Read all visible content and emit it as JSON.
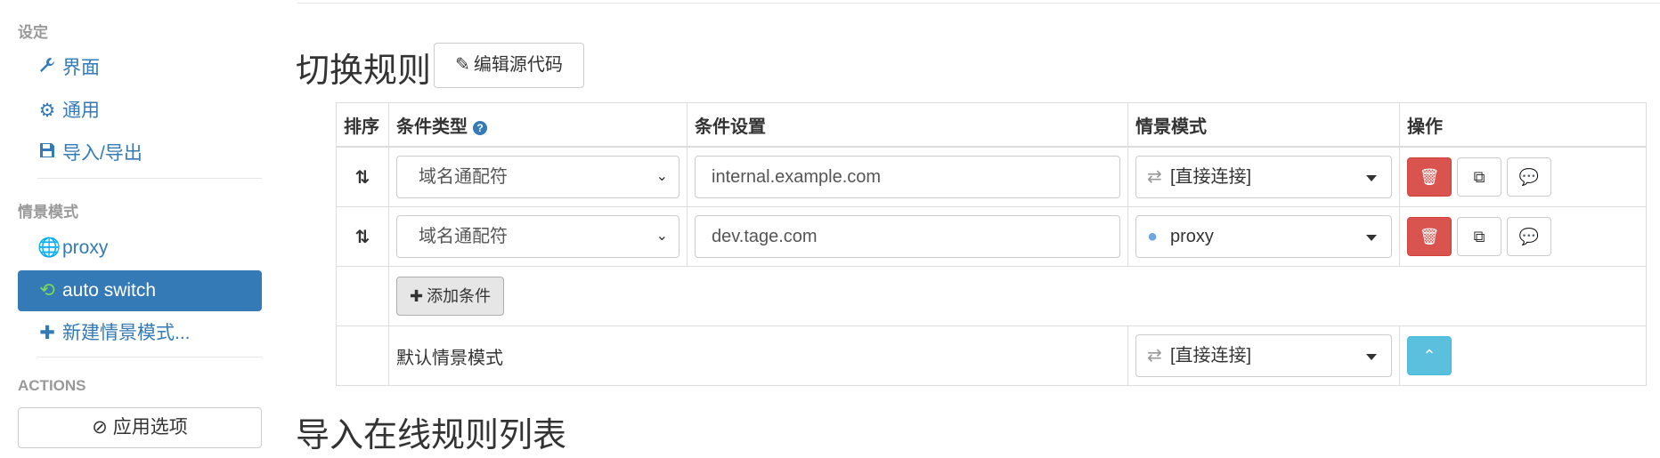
{
  "sidebar": {
    "settings_header": "设定",
    "settings_items": [
      {
        "label": "界面",
        "icon": "wrench-icon"
      },
      {
        "label": "通用",
        "icon": "gear-icon"
      },
      {
        "label": "导入/导出",
        "icon": "save-icon"
      }
    ],
    "profiles_header": "情景模式",
    "profile_items": [
      {
        "label": "proxy",
        "icon": "globe-icon",
        "active": false
      },
      {
        "label": "auto switch",
        "icon": "retweet-icon",
        "active": true
      },
      {
        "label": "新建情景模式...",
        "icon": "plus-icon",
        "active": false
      }
    ],
    "actions_header": "ACTIONS",
    "apply_label": "应用选项"
  },
  "main": {
    "title": "切换规则",
    "edit_source_label": "编辑源代码",
    "table": {
      "headers": {
        "sort": "排序",
        "condition_type": "条件类型",
        "condition_setting": "条件设置",
        "profile": "情景模式",
        "actions": "操作"
      },
      "rows": [
        {
          "condition_type": "域名通配符",
          "condition_setting": "internal.example.com",
          "profile": "[直接连接]",
          "profile_icon": "exchange-icon"
        },
        {
          "condition_type": "域名通配符",
          "condition_setting": "dev.tage.com",
          "profile": "proxy",
          "profile_icon": "globe-icon"
        }
      ],
      "add_condition_label": "添加条件",
      "default_label": "默认情景模式",
      "default_profile": "[直接连接]"
    },
    "import_title": "导入在线规则列表"
  },
  "colors": {
    "primary": "#337ab7",
    "danger": "#d9534f",
    "info": "#5bc0de"
  }
}
